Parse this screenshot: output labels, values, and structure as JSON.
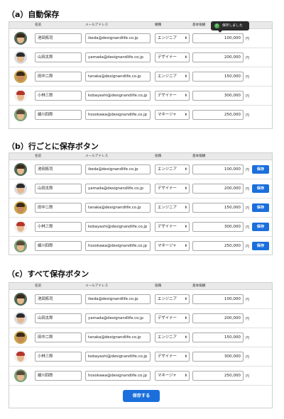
{
  "sections": [
    {
      "title": "（a）自動保存",
      "headers": {
        "name": "名前",
        "email": "メールアドレス",
        "role": "職種",
        "salary": "基本報酬"
      },
      "toast": "保存しました"
    },
    {
      "title": "（b）行ごとに保存ボタン",
      "headers": {
        "name": "名前",
        "email": "メールアドレス",
        "role": "役職",
        "salary": "基本報酬"
      },
      "row_button": "保存"
    },
    {
      "title": "（c）すべて保存ボタン",
      "headers": {
        "name": "名前",
        "email": "メールアドレス",
        "role": "役職",
        "salary": "基本報酬"
      },
      "save_all_button": "保存する"
    }
  ],
  "rows_a": [
    {
      "name": "池田拓司",
      "email": "ikeda@designandlife.co.jp",
      "role": "エンジニア",
      "salary": "100,000",
      "unit": "円"
    },
    {
      "name": "山田太郎",
      "email": "yamada@designandlife.co.jp",
      "role": "デザイナー",
      "salary": "200,000",
      "unit": "円"
    },
    {
      "name": "田中二郎",
      "email": "tanaka@designandlife.co.jp",
      "role": "エンジニア",
      "salary": "150,000",
      "unit": "円"
    },
    {
      "name": "小林三郎",
      "email": "kobayashi@designandlife.co.jp",
      "role": "デザイナー",
      "salary": "300,000",
      "unit": "円"
    },
    {
      "name": "細川四郎",
      "email": "hosokawa@designandlife.co.jp",
      "role": "マネージャ",
      "salary": "250,000",
      "unit": "円"
    }
  ],
  "rows_bc": [
    {
      "name": "池田拓司",
      "email": "ikeda@designandlife.co.jp",
      "role": "エンジニア",
      "salary": "100,000",
      "unit": "円"
    },
    {
      "name": "山田太郎",
      "email": "yamada@designandlife.co.jp",
      "role": "デザイナー",
      "salary": "200,000",
      "unit": "円"
    },
    {
      "name": "田中二郎",
      "email": "tanaka@designandlife.co.jp",
      "role": "エンジニア",
      "salary": "150,000",
      "unit": "円"
    },
    {
      "name": "小林三郎",
      "email": "kobayashi@designandlife.co.jp",
      "role": "デザイナー",
      "salary": "300,000",
      "unit": "円"
    },
    {
      "name": "細川四郎",
      "email": "hosokawa@designandlife.co.jp",
      "role": "マネージャ",
      "salary": "250,000",
      "unit": "円"
    }
  ],
  "select_chevron": "⬍",
  "colors": {
    "primary_button": "#1a6fdc",
    "toast_bg": "#2c2c2c",
    "toast_check": "#4caf50",
    "header_bg": "#e9e9e9"
  }
}
